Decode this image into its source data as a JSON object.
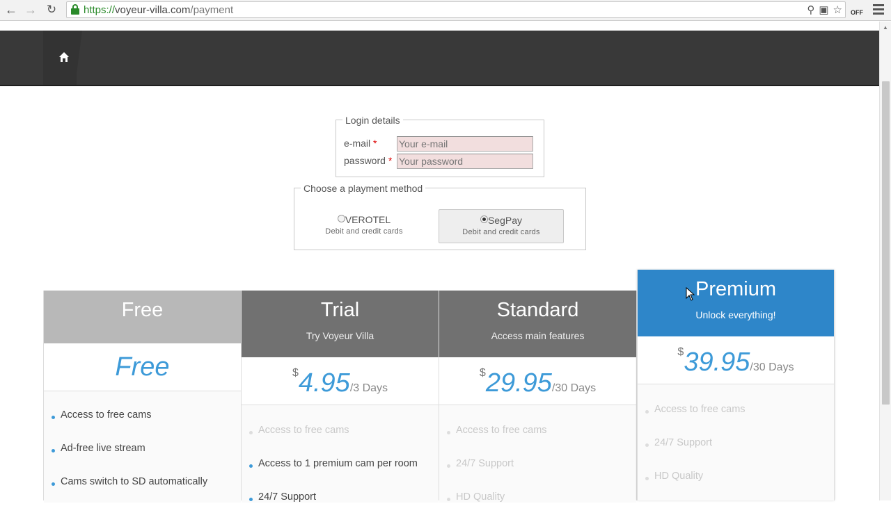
{
  "browser": {
    "url_scheme": "https://",
    "url_host": "voyeur-villa.com",
    "url_path": "/payment",
    "ext_badge": "OFF"
  },
  "login": {
    "legend": "Login details",
    "email_label": "e-mail",
    "email_placeholder": "Your e-mail",
    "password_label": "password",
    "password_placeholder": "Your password",
    "required_mark": "*"
  },
  "payment": {
    "legend": "Choose a playment method",
    "options": [
      {
        "name": "VEROTEL",
        "desc": "Debit and credit cards",
        "selected": false
      },
      {
        "name": "SegPay",
        "desc": "Debit and credit cards",
        "selected": true
      }
    ]
  },
  "plans": [
    {
      "name": "Free",
      "subtitle": "",
      "price_free_text": "Free",
      "header_color": "#b8b8b8",
      "features": [
        {
          "text": "Access to free cams",
          "muted": false
        },
        {
          "text": "Ad-free live stream",
          "muted": false
        },
        {
          "text": "Cams switch to SD automatically",
          "muted": false
        }
      ]
    },
    {
      "name": "Trial",
      "subtitle": "Try Voyeur Villa",
      "currency": "$",
      "amount": "4.95",
      "period": "/3 Days",
      "header_color": "#717171",
      "features": [
        {
          "text": "Access to free cams",
          "muted": true
        },
        {
          "text": "Access to 1 premium cam per room",
          "muted": false
        },
        {
          "text": "24/7 Support",
          "muted": false
        }
      ]
    },
    {
      "name": "Standard",
      "subtitle": "Access main features",
      "currency": "$",
      "amount": "29.95",
      "period": "/30 Days",
      "header_color": "#717171",
      "features": [
        {
          "text": "Access to free cams",
          "muted": true
        },
        {
          "text": "24/7 Support",
          "muted": true
        },
        {
          "text": "HD Quality",
          "muted": true
        }
      ]
    },
    {
      "name": "Premium",
      "subtitle": "Unlock everything!",
      "currency": "$",
      "amount": "39.95",
      "period": "/30 Days",
      "header_color": "#2e86c9",
      "features": [
        {
          "text": "Access to free cams",
          "muted": true
        },
        {
          "text": "24/7 Support",
          "muted": true
        },
        {
          "text": "HD Quality",
          "muted": true
        }
      ]
    }
  ]
}
